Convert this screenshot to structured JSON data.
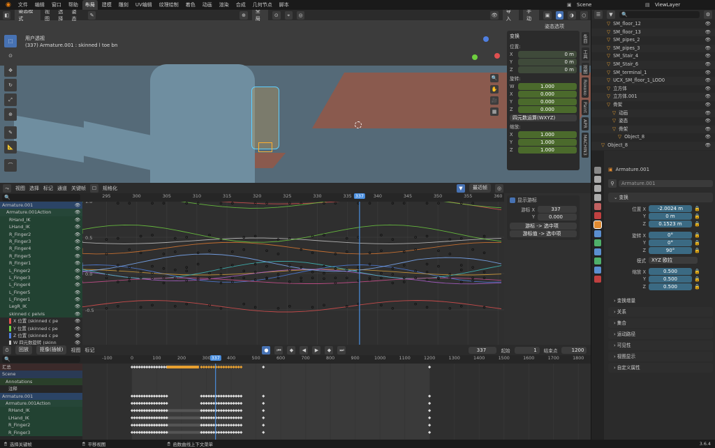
{
  "topbar": {
    "menus": [
      "文件",
      "编辑",
      "窗口",
      "帮助"
    ],
    "workspaces": [
      "布局",
      "建模",
      "雕刻",
      "UV编辑",
      "纹理绘制",
      "着色",
      "动画",
      "渲染",
      "合成",
      "几何节点",
      "脚本"
    ],
    "active_workspace": "布局",
    "scene": "Scene",
    "view_layer": "ViewLayer"
  },
  "viewport": {
    "mode": "姿态模式",
    "menu": [
      "视图",
      "选择",
      "姿态"
    ],
    "orientation": "全局",
    "view_name": "用户透视",
    "object_info": "(337) Armature.001 : skinned l toe bn",
    "overlay_btns": [
      "导入",
      "手动"
    ],
    "pose_options": "姿态选项",
    "side_tabs": [
      "条目",
      "工具",
      "视图",
      "Rokoko",
      "Paint",
      "APR",
      "MACHIN3"
    ]
  },
  "transform_panel": {
    "title": "变换",
    "location_label": "位置:",
    "location": [
      {
        "axis": "X",
        "value": "0 m"
      },
      {
        "axis": "Y",
        "value": "0 m"
      },
      {
        "axis": "Z",
        "value": "0 m"
      }
    ],
    "rotation_label": "旋转:",
    "rotation": [
      {
        "axis": "W",
        "value": "1.000"
      },
      {
        "axis": "X",
        "value": "0.000"
      },
      {
        "axis": "Y",
        "value": "0.000"
      },
      {
        "axis": "Z",
        "value": "0.000"
      }
    ],
    "rotation_mode": "四元数运算(WXYZ)",
    "scale_label": "缩放:",
    "scale": [
      {
        "axis": "X",
        "value": "1.000"
      },
      {
        "axis": "Y",
        "value": "1.000"
      },
      {
        "axis": "Z",
        "value": "1.000"
      }
    ]
  },
  "graph_editor": {
    "menu": [
      "视图",
      "选择",
      "标记",
      "通道",
      "关键帧",
      "规格化"
    ],
    "pivot": "最近帧",
    "ticks": [
      "295",
      "300",
      "305",
      "310",
      "315",
      "320",
      "325",
      "330",
      "335",
      "337",
      "340",
      "345",
      "350",
      "355",
      "360"
    ],
    "y_labels": [
      "1.0",
      "0.5",
      "0.0",
      "-0.5"
    ],
    "current_frame": "337",
    "channels": [
      {
        "name": "Armature.001",
        "kind": "object"
      },
      {
        "name": "Armature.001Action",
        "kind": "action"
      },
      {
        "name": "RHand_IK",
        "kind": "bone"
      },
      {
        "name": "LHand_IK",
        "kind": "bone"
      },
      {
        "name": "R_Finger2",
        "kind": "bone"
      },
      {
        "name": "R_Finger3",
        "kind": "bone"
      },
      {
        "name": "R_Finger4",
        "kind": "bone"
      },
      {
        "name": "R_Finger5",
        "kind": "bone"
      },
      {
        "name": "R_Finger1",
        "kind": "bone"
      },
      {
        "name": "L_Finger2",
        "kind": "bone"
      },
      {
        "name": "L_Finger3",
        "kind": "bone"
      },
      {
        "name": "L_Finger4",
        "kind": "bone"
      },
      {
        "name": "L_Finger5",
        "kind": "bone"
      },
      {
        "name": "L_Finger1",
        "kind": "bone"
      },
      {
        "name": "LegR_IK",
        "kind": "bone"
      },
      {
        "name": "skinned c pelvis",
        "kind": "bone"
      },
      {
        "name": "X 位置 (skinned c pe",
        "kind": "fcurve",
        "color": "#e05050"
      },
      {
        "name": "Y 位置 (skinned c pe",
        "kind": "fcurve",
        "color": "#6fcf3f"
      },
      {
        "name": "Z 位置 (skinned c pe",
        "kind": "fcurve",
        "color": "#4f7fe0"
      },
      {
        "name": "W 四元数旋转 (skinn",
        "kind": "fcurve",
        "color": "#c8c8c8"
      }
    ],
    "cursor_panel": {
      "title": "显示游标",
      "x_label": "游标 X",
      "x_value": "337",
      "y_label": "Y",
      "y_value": "0.000",
      "btn1": "游标 -> 选中项",
      "btn2": "游标值 -> 选中项"
    }
  },
  "timeline": {
    "mode": "回放",
    "menu": [
      "抠像(插帧)",
      "视图",
      "标记"
    ],
    "current": "337",
    "start_label": "起始",
    "start": "1",
    "end_label": "结束点",
    "end": "1200"
  },
  "dopesheet": {
    "ticks": [
      "-100",
      "0",
      "100",
      "200",
      "300",
      "337",
      "400",
      "500",
      "600",
      "700",
      "800",
      "900",
      "1000",
      "1100",
      "1200",
      "1300",
      "1400",
      "1500",
      "1600",
      "1700",
      "1800"
    ],
    "channels": [
      {
        "name": "汇总",
        "kind": "summary"
      },
      {
        "name": "Scene",
        "kind": "scene"
      },
      {
        "name": "Annotations",
        "kind": "sub"
      },
      {
        "name": "注释",
        "kind": "plain"
      },
      {
        "name": "Armature.001",
        "kind": "object"
      },
      {
        "name": "Armature.001Action",
        "kind": "action"
      },
      {
        "name": "RHand_IK",
        "kind": "bone"
      },
      {
        "name": "LHand_IK",
        "kind": "bone"
      },
      {
        "name": "R_Finger2",
        "kind": "bone"
      },
      {
        "name": "R_Finger3",
        "kind": "bone"
      }
    ]
  },
  "outliner": {
    "items": [
      {
        "name": "SM_floor_12",
        "indent": 2
      },
      {
        "name": "SM_floor_13",
        "indent": 2
      },
      {
        "name": "SM_pipes_2",
        "indent": 2
      },
      {
        "name": "SM_pipes_3",
        "indent": 2
      },
      {
        "name": "SM_Stair_4",
        "indent": 2
      },
      {
        "name": "SM_Stair_6",
        "indent": 2
      },
      {
        "name": "SM_terminal_1",
        "indent": 2
      },
      {
        "name": "UCX_SM_floor_1_LOD0",
        "indent": 2
      },
      {
        "name": "立方体",
        "indent": 2
      },
      {
        "name": "立方体.001",
        "indent": 2
      },
      {
        "name": "骨架",
        "indent": 2
      },
      {
        "name": "动画",
        "indent": 3
      },
      {
        "name": "姿态",
        "indent": 3
      },
      {
        "name": "骨架",
        "indent": 3
      },
      {
        "name": "Object_8",
        "indent": 4
      },
      {
        "name": "Object_8",
        "indent": 1
      }
    ]
  },
  "properties": {
    "object_name": "Armature.001",
    "data_name": "Armature.001",
    "section": "变换",
    "location_label": "位置 X",
    "location": [
      "-2.0024 m",
      "0 m",
      "0.1523 m"
    ],
    "rotation_label": "旋转 X",
    "rotation": [
      "0°",
      "0°",
      "90°"
    ],
    "mode_label": "模式",
    "mode": "XYZ 欧拉",
    "scale_label": "缩放 X",
    "scale": [
      "0.500",
      "0.500",
      "0.500"
    ],
    "axis_y": "Y",
    "axis_z": "Z",
    "delta": "变换增量",
    "sections": [
      "关系",
      "集合",
      "运动路径",
      "可见性",
      "视图显示",
      "自定义属性"
    ]
  },
  "statusbar": {
    "items": [
      "选择关键帧",
      "平移视图",
      "函数曲线上下文菜单"
    ],
    "version": "3.6.4"
  },
  "colors": {
    "accent": "#4772b3",
    "green_field": "#4b6a2c",
    "blue_field": "#3b6a83",
    "playhead": "#4a8fe0",
    "orange": "#e8a030"
  }
}
